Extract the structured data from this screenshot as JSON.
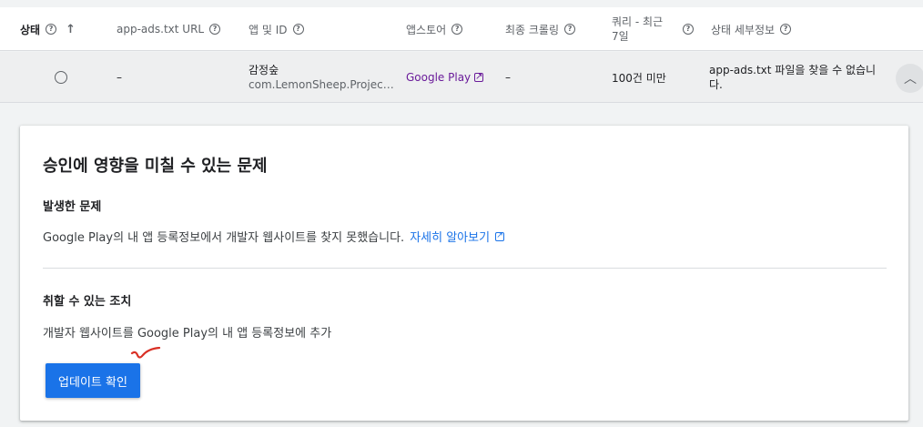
{
  "table": {
    "headers": {
      "status": "상태",
      "url": "app-ads.txt URL",
      "app": "앱 및 ID",
      "store": "앱스토어",
      "crawl": "최종 크롤링",
      "query": "쿼리 - 최근 7일",
      "detail": "상태 세부정보"
    },
    "row": {
      "url": "–",
      "app_name": "감정숲",
      "app_id": "com.LemonSheep.Project…",
      "store": "Google Play",
      "crawl": "–",
      "query": "100건 미만",
      "detail": "app-ads.txt 파일을 찾을 수 없습니다."
    }
  },
  "card": {
    "title": "승인에 영향을 미칠 수 있는 문제",
    "issue_title": "발생한 문제",
    "issue_text": "Google Play의 내 앱 등록정보에서 개발자 웹사이트를 찾지 못했습니다.",
    "learn_more": "자세히 알아보기",
    "action_title": "취할 수 있는 조치",
    "action_text": "개발자 웹사이트를 Google Play의 내 앱 등록정보에 추가",
    "button": "업데이트 확인"
  },
  "icons": {
    "help": "help-circle-icon",
    "sort": "arrow-up-icon",
    "status": "circle-outline-icon",
    "external": "open-in-new-icon",
    "expand": "chevron-up-icon"
  },
  "colors": {
    "accent": "#1a73e8",
    "store_link": "#6a1b9a",
    "annotation": "#d93025"
  }
}
